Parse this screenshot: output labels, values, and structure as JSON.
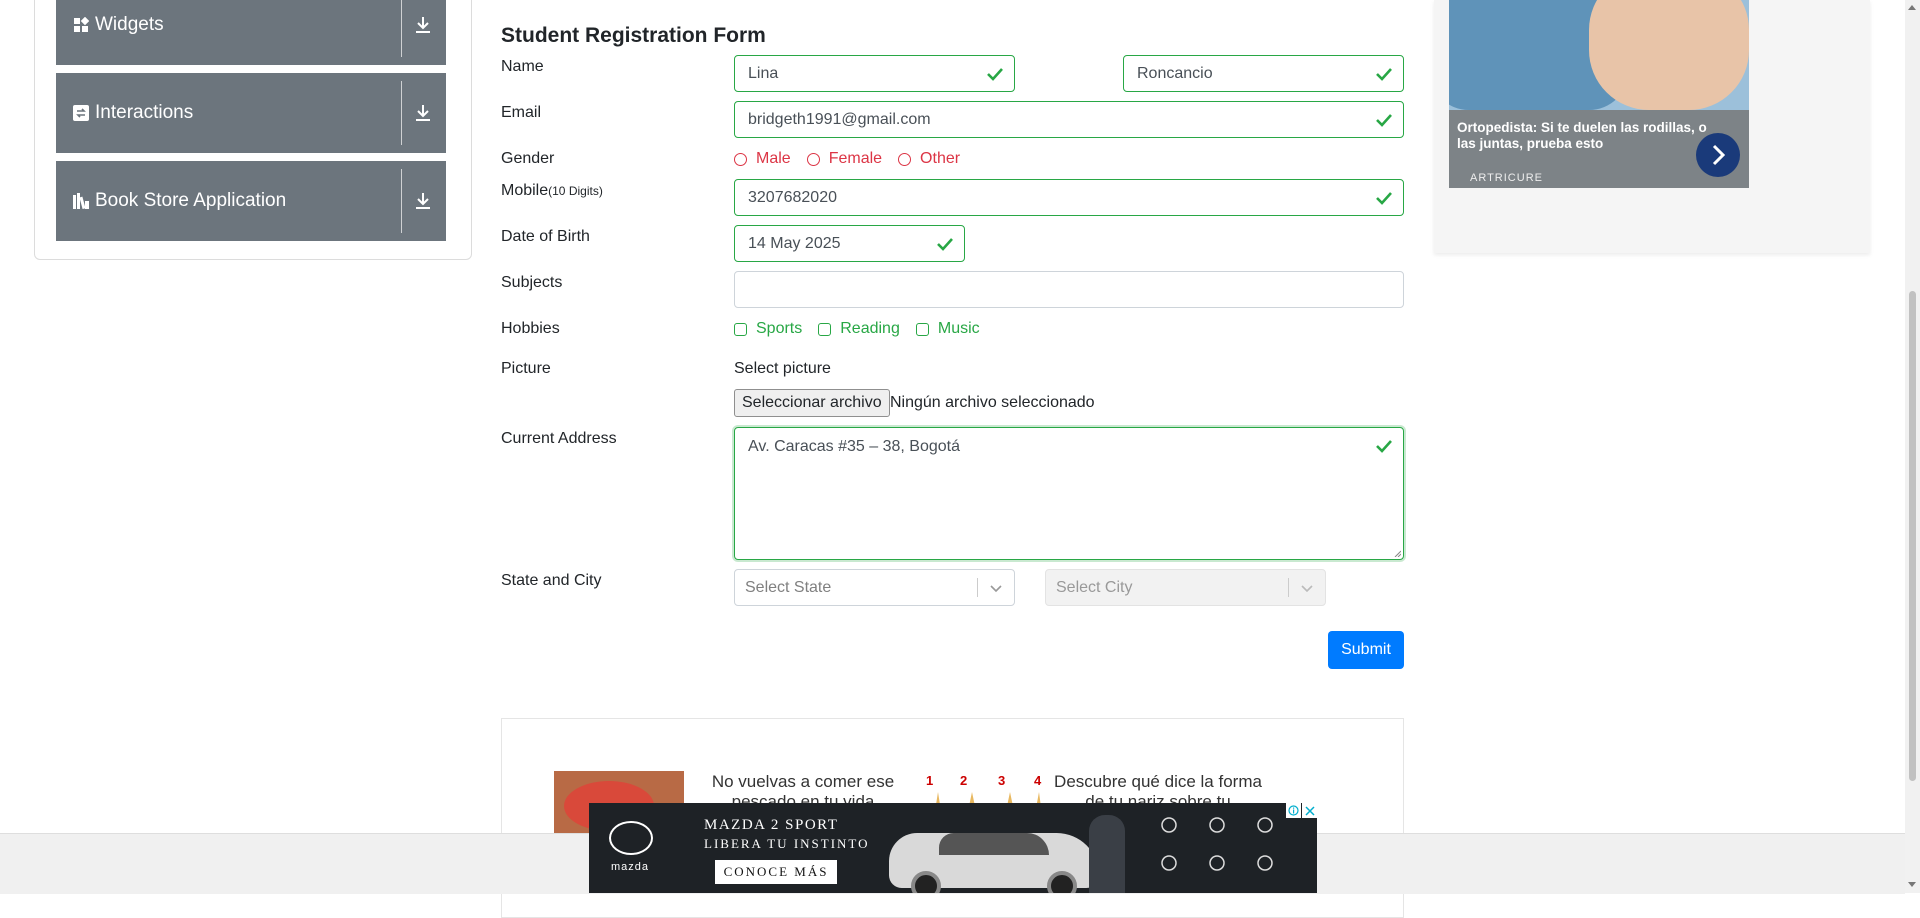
{
  "sidebar": {
    "groups": [
      {
        "label": "Widgets",
        "icon": "widgets-icon"
      },
      {
        "label": "Interactions",
        "icon": "interactions-icon"
      },
      {
        "label": "Book Store Application",
        "icon": "book-store-icon"
      }
    ]
  },
  "form": {
    "title": "Student Registration Form",
    "labels": {
      "name": "Name",
      "email": "Email",
      "gender": "Gender",
      "mobile": "Mobile",
      "mobile_hint": "(10 Digits)",
      "dob": "Date of Birth",
      "subjects": "Subjects",
      "hobbies": "Hobbies",
      "picture": "Picture",
      "address": "Current Address",
      "state_city": "State and City"
    },
    "first_name": "Lina",
    "last_name": "Roncancio",
    "email": "bridgeth1991@gmail.com",
    "gender_options": [
      "Male",
      "Female",
      "Other"
    ],
    "mobile": "3207682020",
    "dob": "14 May 2025",
    "subjects": "",
    "hobbies": [
      "Sports",
      "Reading",
      "Music"
    ],
    "picture_label": "Select picture",
    "file_button": "Seleccionar archivo",
    "file_status": "Ningún archivo seleccionado",
    "address": "Av. Caracas #35 – 38, Bogotá",
    "state_placeholder": "Select State",
    "city_placeholder": "Select City",
    "submit": "Submit",
    "valid_color": "#28a745",
    "invalid_color": "#dc3545",
    "primary_color": "#007bff"
  },
  "ads": {
    "right": {
      "headline": "Ortopedista: Si te duelen las rodillas, o las juntas, prueba esto",
      "brand": "ARTRICURE"
    },
    "content": {
      "left_text": "No vuelvas a comer ese pescado en tu vida",
      "numbers": [
        "1",
        "2",
        "3",
        "4"
      ],
      "right_text": "Descubre qué dice la forma de tu nariz sobre tu"
    },
    "banner": {
      "brand": "mazda",
      "line1": "MAZDA 2 SPORT",
      "line2": "LIBERA TU INSTINTO",
      "cta": "CONOCE MÁS",
      "close": "✕"
    }
  }
}
